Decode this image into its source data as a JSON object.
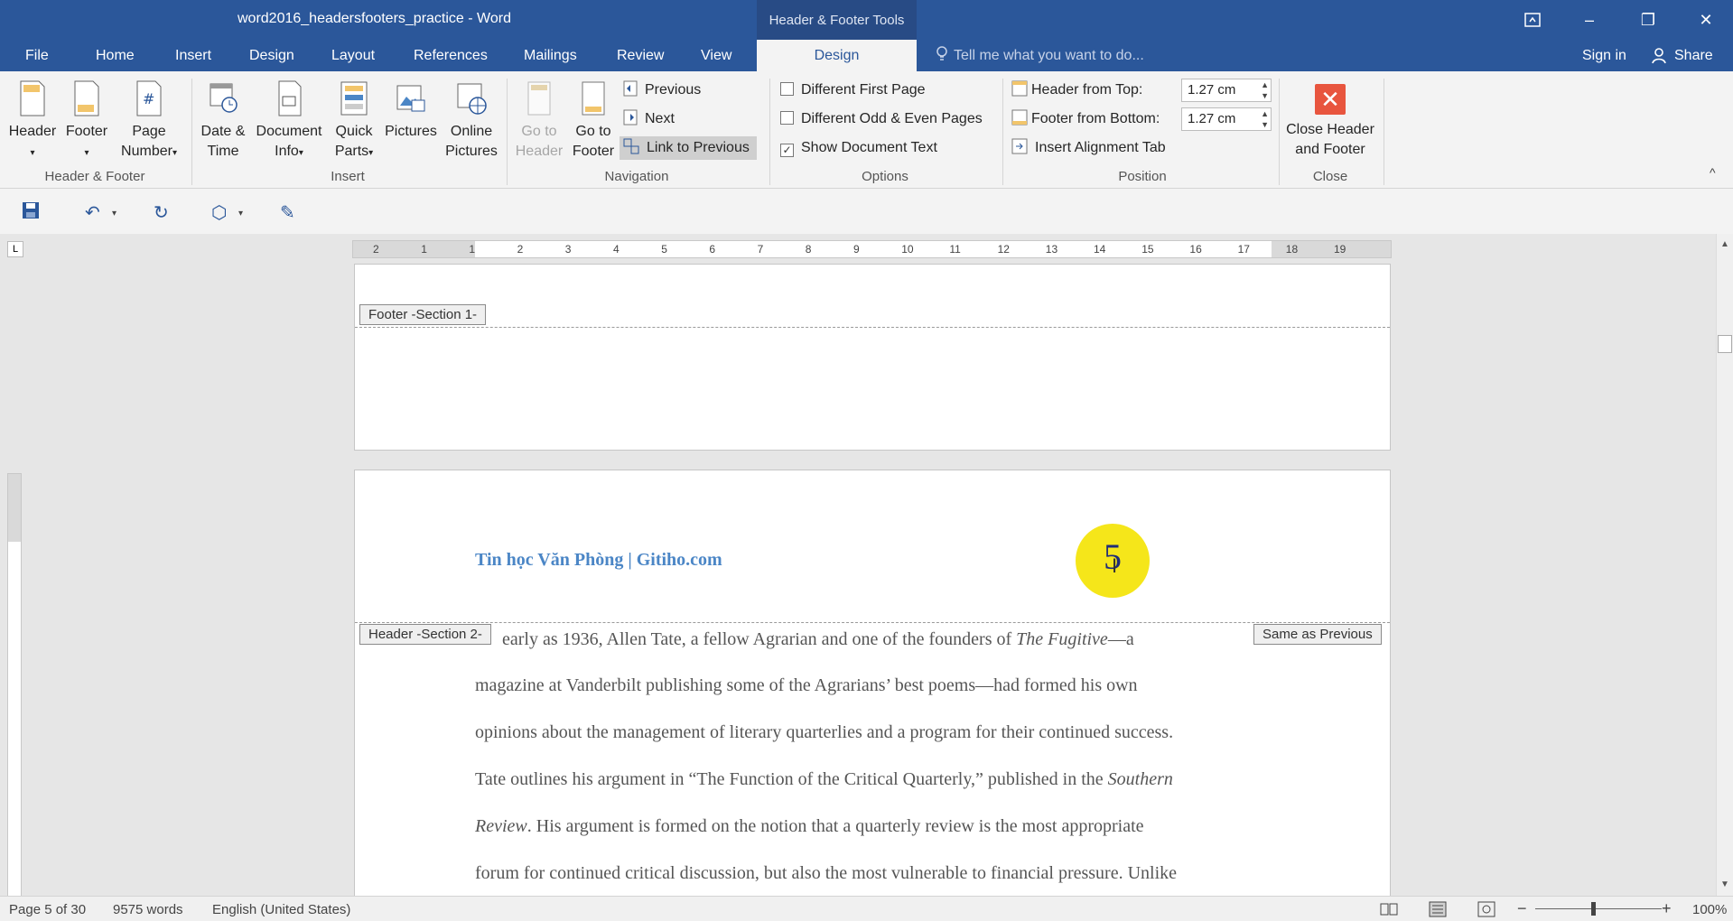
{
  "titlebar": {
    "doc_title": "word2016_headersfooters_practice - Word",
    "context_tools": "Header & Footer Tools",
    "restore_icon": "ribbon-display-icon",
    "minimize": "–",
    "maximize": "❐",
    "close": "✕"
  },
  "tabs": {
    "file": "File",
    "home": "Home",
    "insert": "Insert",
    "design": "Design",
    "layout": "Layout",
    "references": "References",
    "mailings": "Mailings",
    "review": "Review",
    "view": "View",
    "active_design": "Design",
    "tell_me": "Tell me what you want to do...",
    "sign_in": "Sign in",
    "share": "Share"
  },
  "ribbon": {
    "header": "Header",
    "footer": "Footer",
    "page_number_1": "Page",
    "page_number_2": "Number",
    "group_header_footer": "Header & Footer",
    "date_time_1": "Date &",
    "date_time_2": "Time",
    "doc_info_1": "Document",
    "doc_info_2": "Info",
    "quick_parts_1": "Quick",
    "quick_parts_2": "Parts",
    "pictures": "Pictures",
    "online_pictures_1": "Online",
    "online_pictures_2": "Pictures",
    "group_insert": "Insert",
    "go_to_header_1": "Go to",
    "go_to_header_2": "Header",
    "go_to_footer_1": "Go to",
    "go_to_footer_2": "Footer",
    "previous": "Previous",
    "next": "Next",
    "link_to_previous": "Link to Previous",
    "group_navigation": "Navigation",
    "diff_first_page": "Different First Page",
    "diff_odd_even": "Different Odd & Even Pages",
    "show_doc_text": "Show Document Text",
    "group_options": "Options",
    "header_from_top": "Header from Top:",
    "header_from_top_value": "1.27 cm",
    "footer_from_bottom": "Footer from Bottom:",
    "footer_from_bottom_value": "1.27 cm",
    "insert_alignment_tab": "Insert Alignment Tab",
    "group_position": "Position",
    "close_hf_1": "Close Header",
    "close_hf_2": "and Footer",
    "group_close": "Close",
    "collapse": "^"
  },
  "ruler_ticks": [
    "2",
    "1",
    "1",
    "2",
    "3",
    "4",
    "5",
    "6",
    "7",
    "8",
    "9",
    "10",
    "11",
    "12",
    "13",
    "14",
    "15",
    "16",
    "17",
    "18",
    "19"
  ],
  "document": {
    "footer_tag": "Footer -Section 1-",
    "header_tag": "Header -Section 2-",
    "same_as_previous": "Same as Previous",
    "header_text": "Tin học Văn Phòng | Gitiho.com",
    "page_number": "5",
    "lines": [
      "early as 1936, Allen Tate, a fellow Agrarian and one of the founders of ",
      "The Fugitive",
      "—a",
      "magazine at Vanderbilt publishing some of the Agrarians’ best poems—had formed his own",
      "opinions about the management of literary quarterlies and a program for their continued success.",
      "Tate outlines his argument in “The Function of the Critical Quarterly,” published in the ",
      "Southern",
      "Review",
      ". His argument is formed on the notion that a quarterly review is the most appropriate",
      "forum for continued critical discussion, but also the most vulnerable to financial pressure. Unlike"
    ]
  },
  "status": {
    "page": "Page 5 of 30",
    "words": "9575 words",
    "language": "English (United States)",
    "zoom": "100%",
    "zoom_minus": "−",
    "zoom_plus": "+"
  }
}
